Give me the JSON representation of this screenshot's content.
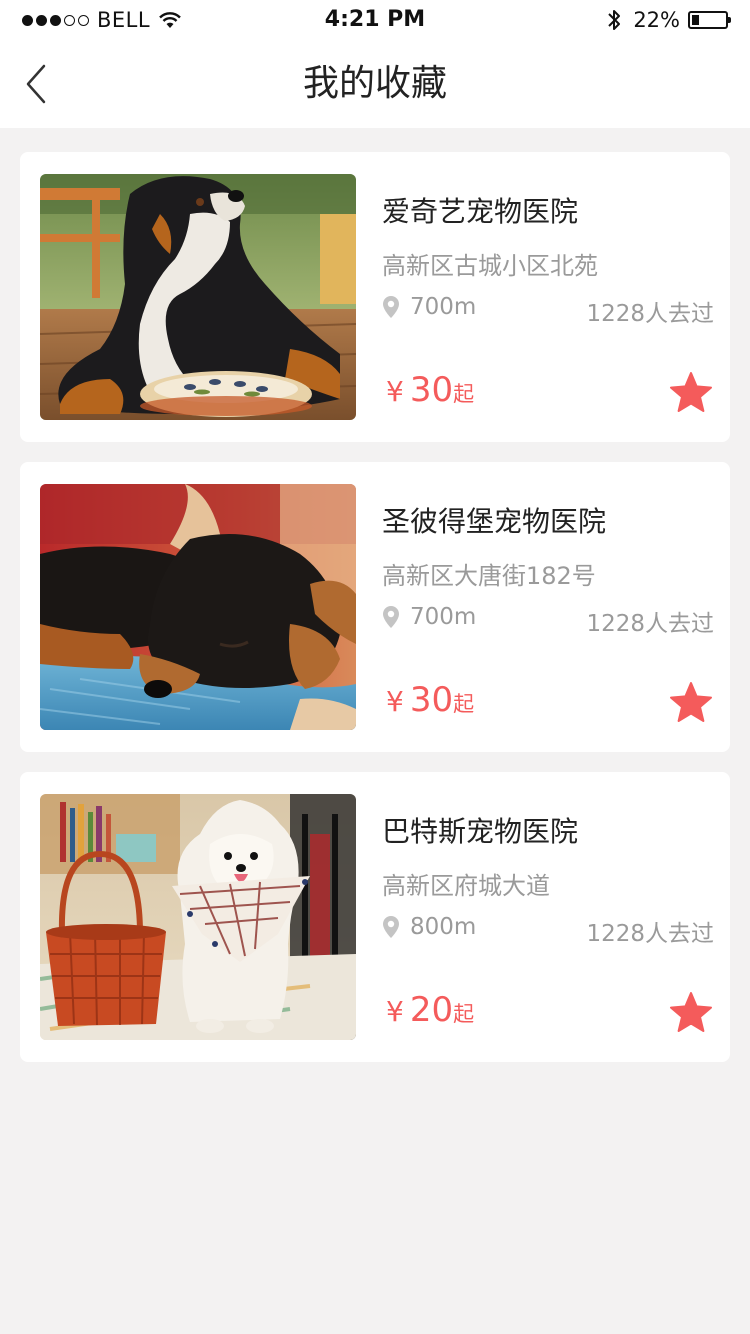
{
  "status_bar": {
    "carrier": "BELL",
    "time": "4:21 PM",
    "battery": "22%",
    "battery_level": 0.22
  },
  "nav": {
    "title": "我的收藏",
    "back_icon": "chevron-left-icon"
  },
  "accent_color": "#f45b5b",
  "favorites": [
    {
      "name": "爱奇艺宠物医院",
      "address": "高新区古城小区北苑",
      "distance": "700m",
      "visits": "1228人去过",
      "currency": "¥",
      "price": "30",
      "price_suffix": "起",
      "image": "bernese-dog-photo"
    },
    {
      "name": "圣彼得堡宠物医院",
      "address": "高新区大唐街182号",
      "distance": "700m",
      "visits": "1228人去过",
      "currency": "¥",
      "price": "30",
      "price_suffix": "起",
      "image": "sleeping-puppy-photo"
    },
    {
      "name": "巴特斯宠物医院",
      "address": "高新区府城大道",
      "distance": "800m",
      "visits": "1228人去过",
      "currency": "¥",
      "price": "20",
      "price_suffix": "起",
      "image": "pomeranian-basket-photo"
    }
  ]
}
